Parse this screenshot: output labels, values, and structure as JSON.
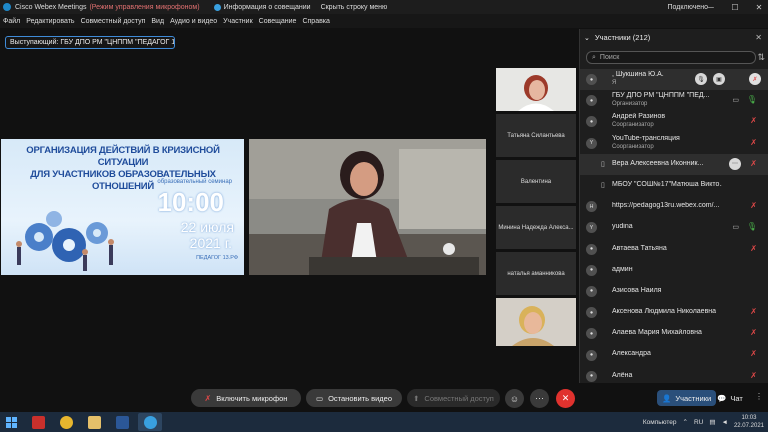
{
  "titlebar": {
    "app_title": "Cisco Webex Meetings",
    "mic_mode": "(Режим управления микрофоном)",
    "meeting_info": "Информация о совещании",
    "hide_menu": "Скрыть строку меню",
    "status": "Подключено",
    "minimize": "─",
    "maximize": "☐",
    "close": "✕"
  },
  "menu": [
    "Файл",
    "Редактировать",
    "Совместный доступ",
    "Вид",
    "Аудио и видео",
    "Участник",
    "Совещание",
    "Справка"
  ],
  "speaker": "Выступающий: ГБУ ДПО РМ \"ЦНППМ \"ПЕДАГОГ 1...",
  "slide": {
    "title_line1": "ОРГАНИЗАЦИЯ ДЕЙСТВИЙ В КРИЗИСНОЙ СИТУАЦИИ",
    "title_line2": "ДЛЯ УЧАСТНИКОВ ОБРАЗОВАТЕЛЬНЫХ ОТНОШЕНИЙ",
    "subtitle": "образовательный семинар",
    "time": "10:00",
    "date": "22 июля",
    "year": "2021 г.",
    "brand": "ПЕДАГОГ 13.РФ"
  },
  "thumbnails": [
    {
      "label": "",
      "kind": "video"
    },
    {
      "label": "Татьяна Силантьева",
      "kind": "name"
    },
    {
      "label": "Валентина",
      "kind": "name"
    },
    {
      "label": "Минина Надежда Алекса...",
      "kind": "name"
    },
    {
      "label": "наталья аманникова",
      "kind": "name"
    },
    {
      "label": "",
      "kind": "video"
    }
  ],
  "panel": {
    "title": "Участники (212)",
    "search_placeholder": "Поиск",
    "participants": [
      {
        "avatar": "👤",
        "name": ", Шукшина Ю.А.",
        "role": "Я",
        "mic": "muted",
        "highlight": true,
        "actions": true
      },
      {
        "avatar": "👤",
        "name": "ГБУ ДПО РМ \"ЦНППМ \"ПЕД...",
        "role": "Организатор",
        "mic": "on",
        "cam": true
      },
      {
        "avatar": "👤",
        "name": "Андрей Разинов",
        "role": "Соорганизатор",
        "mic": "muted"
      },
      {
        "avatar": "Y",
        "name": "YouTube-трансляция",
        "role": "Соорганизатор",
        "mic": "muted"
      },
      {
        "avatar": "👤",
        "name": "Вера Алексеевна Иконник...",
        "role": "",
        "mic": "muted",
        "device": "▯",
        "more": true
      },
      {
        "avatar": "",
        "name": "МБОУ \"СОШ№17\"Матюша Викто...",
        "role": "",
        "mic": "",
        "device": "▯"
      },
      {
        "avatar": "H",
        "name": "https://pedagog13ru.webex.com/...",
        "role": "",
        "mic": "muted"
      },
      {
        "avatar": "Y",
        "name": "yudina",
        "role": "",
        "mic": "on",
        "cam": true
      },
      {
        "avatar": "👤",
        "name": "Автаева Татьяна",
        "role": "",
        "mic": "muted"
      },
      {
        "avatar": "👤",
        "name": "админ",
        "role": "",
        "mic": ""
      },
      {
        "avatar": "👤",
        "name": "Азисова Наиля",
        "role": "",
        "mic": ""
      },
      {
        "avatar": "👤",
        "name": "Аксенова Людмила Николаевна",
        "role": "",
        "mic": "muted"
      },
      {
        "avatar": "👤",
        "name": "Алаева Мария Михайловна",
        "role": "",
        "mic": "muted"
      },
      {
        "avatar": "👤",
        "name": "Александра",
        "role": "",
        "mic": "muted"
      },
      {
        "avatar": "👤",
        "name": "Алёна",
        "role": "",
        "mic": "muted"
      }
    ]
  },
  "controls": {
    "mic": "Включить микрофон",
    "video": "Остановить видео",
    "share": "Совместный доступ",
    "participants_tab": "Участники",
    "chat_tab": "Чат"
  },
  "taskbar": {
    "computer": "Компьютер",
    "lang": "RU",
    "time": "10:03",
    "date": "22.07.2021"
  },
  "colors": {
    "accent": "#3f8bd8",
    "muted_red": "#e04848",
    "mic_on_green": "#4bb34b",
    "leave_red": "#e0322e"
  }
}
